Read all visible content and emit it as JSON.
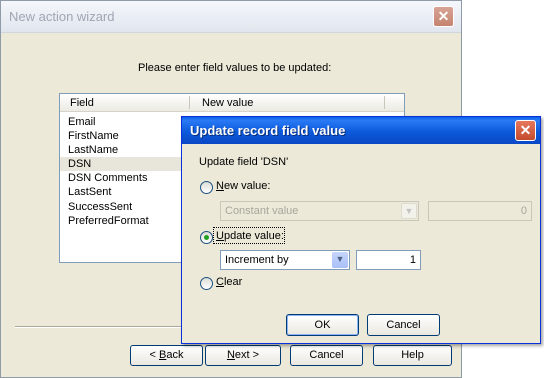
{
  "wizard": {
    "title": "New action wizard",
    "close_glyph": "✕",
    "prompt": "Please enter field values to be updated:",
    "list": {
      "columns": [
        "Field",
        "New value"
      ],
      "rows": [
        "Email",
        "FirstName",
        "LastName",
        "DSN",
        "DSN Comments",
        "LastSent",
        "SuccessSent",
        "PreferredFormat"
      ],
      "selected": "DSN"
    },
    "buttons": {
      "back": {
        "prefix": "< ",
        "mnemonic": "B",
        "rest": "ack"
      },
      "next": {
        "mnemonic": "N",
        "rest": "ext >"
      },
      "cancel": "Cancel",
      "help": "Help"
    }
  },
  "dialog": {
    "title": "Update record field value",
    "close_glyph": "✕",
    "update_field_label": "Update field 'DSN'",
    "new_value": {
      "mnemonic": "N",
      "rest": "ew value:",
      "selected": false,
      "combo_value": "Constant value",
      "number_value": "0"
    },
    "update_value": {
      "mnemonic": "U",
      "rest": "pdate value:",
      "selected": true,
      "combo_value": "Increment by",
      "number_value": "1"
    },
    "clear": {
      "mnemonic": "C",
      "rest": "lear",
      "selected": false
    },
    "ok_label": "OK",
    "cancel_label": "Cancel"
  },
  "icons": {
    "dropdown_arrow": "▼"
  },
  "colors": {
    "dialog_titlebar": "#0A5FE8",
    "inactive_title_text": "#9FA6B2",
    "radio_selected_dot": "#21A121",
    "window_face": "#ECE9D8"
  }
}
